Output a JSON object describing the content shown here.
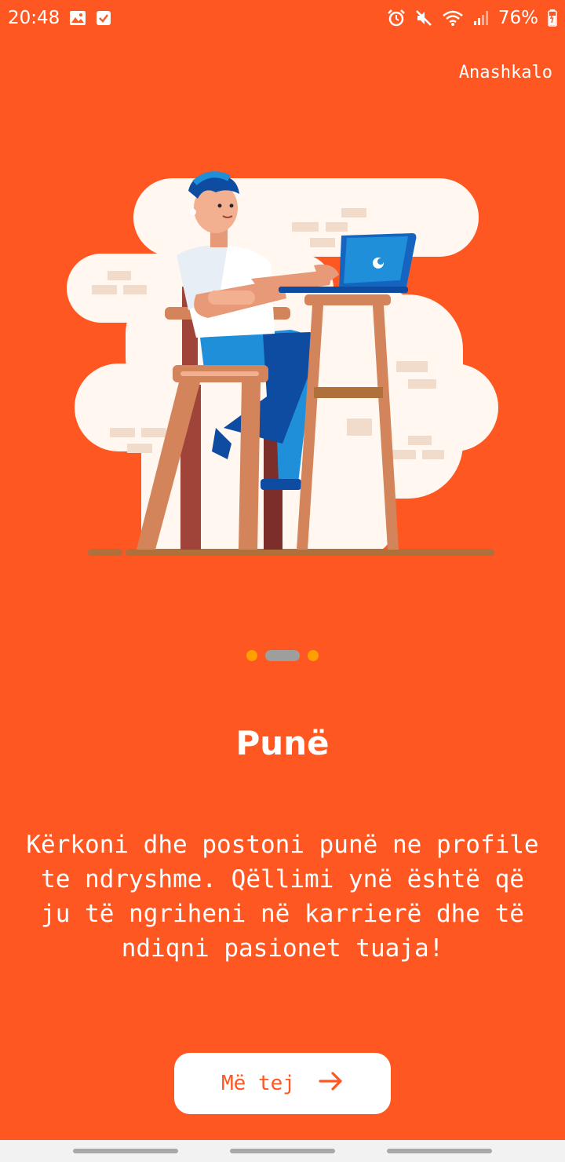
{
  "status_bar": {
    "time": "20:48",
    "battery_percent": "76%",
    "icons_left": [
      "gallery-icon",
      "task-check-icon"
    ],
    "icons_right": [
      "alarm-icon",
      "mute-icon",
      "wifi-icon",
      "signal-icon",
      "battery-charging-icon"
    ]
  },
  "onboarding": {
    "skip_label": "Anashkalo",
    "page_indicator": {
      "count": 3,
      "active_index": 1
    },
    "title": "Punë",
    "description": "Kërkoni dhe postoni punë ne profile te ndryshme. Qëllimi ynë është që ju të ngriheni në karrierë dhe të ndiqni pasionet tuaja!",
    "next_label": "Më tej",
    "illustration": "person-working-on-laptop"
  },
  "colors": {
    "background": "#FF5722",
    "indicator_dot": "#FFA000",
    "indicator_active": "#9E9E9E",
    "button_bg": "#FFFFFF",
    "button_text": "#FF5722"
  }
}
